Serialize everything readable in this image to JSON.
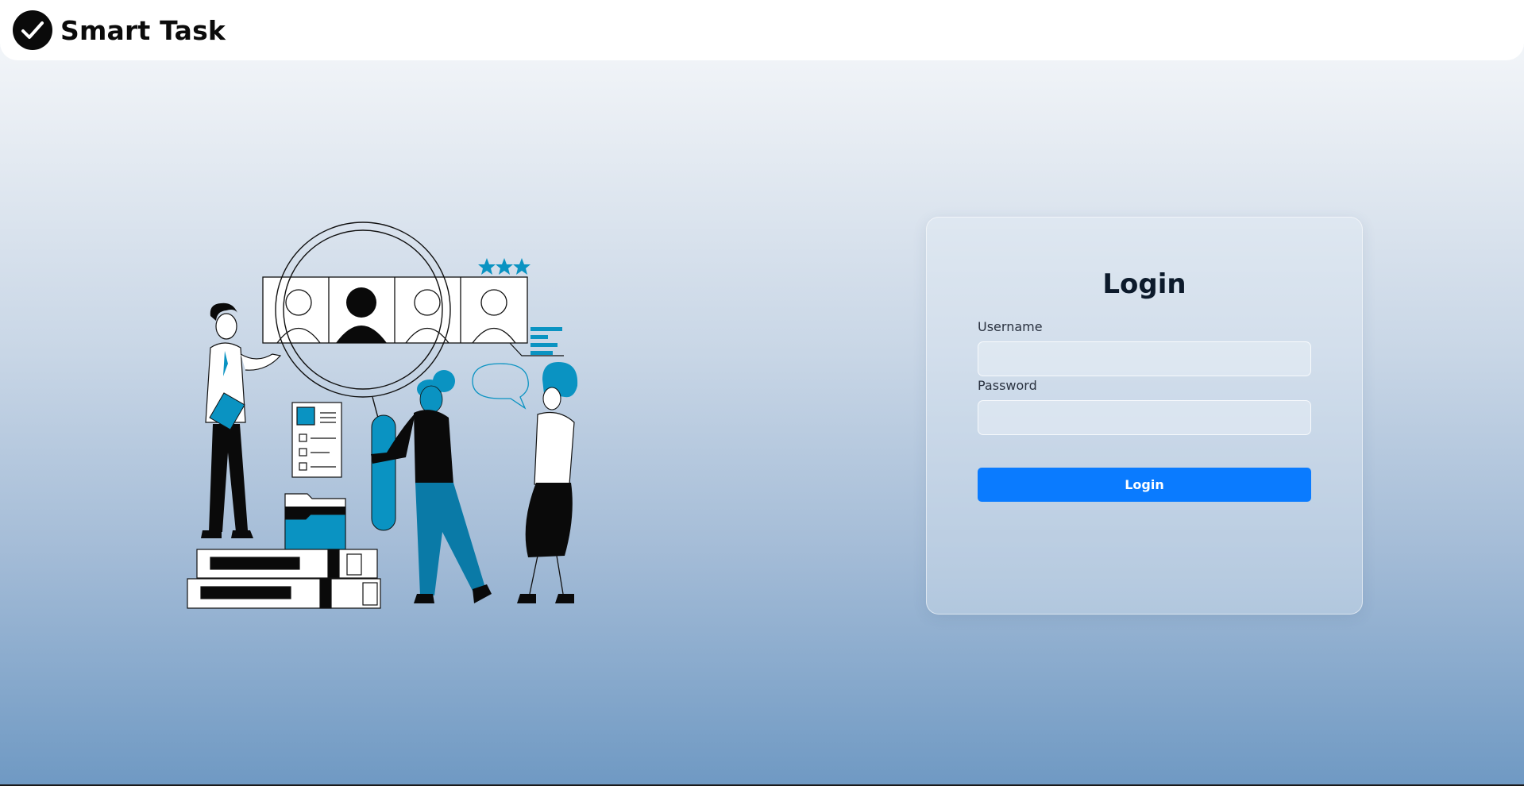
{
  "brand": {
    "name": "Smart Task",
    "logo_icon": "check-circle-icon"
  },
  "login": {
    "title": "Login",
    "username_label": "Username",
    "username_value": "",
    "password_label": "Password",
    "password_value": "",
    "button_label": "Login"
  },
  "illustration": {
    "stars": 3,
    "accent_color": "#0a93c2"
  },
  "colors": {
    "button": "#0a7bff",
    "accent": "#0a93c2",
    "title": "#0c1a2b"
  }
}
